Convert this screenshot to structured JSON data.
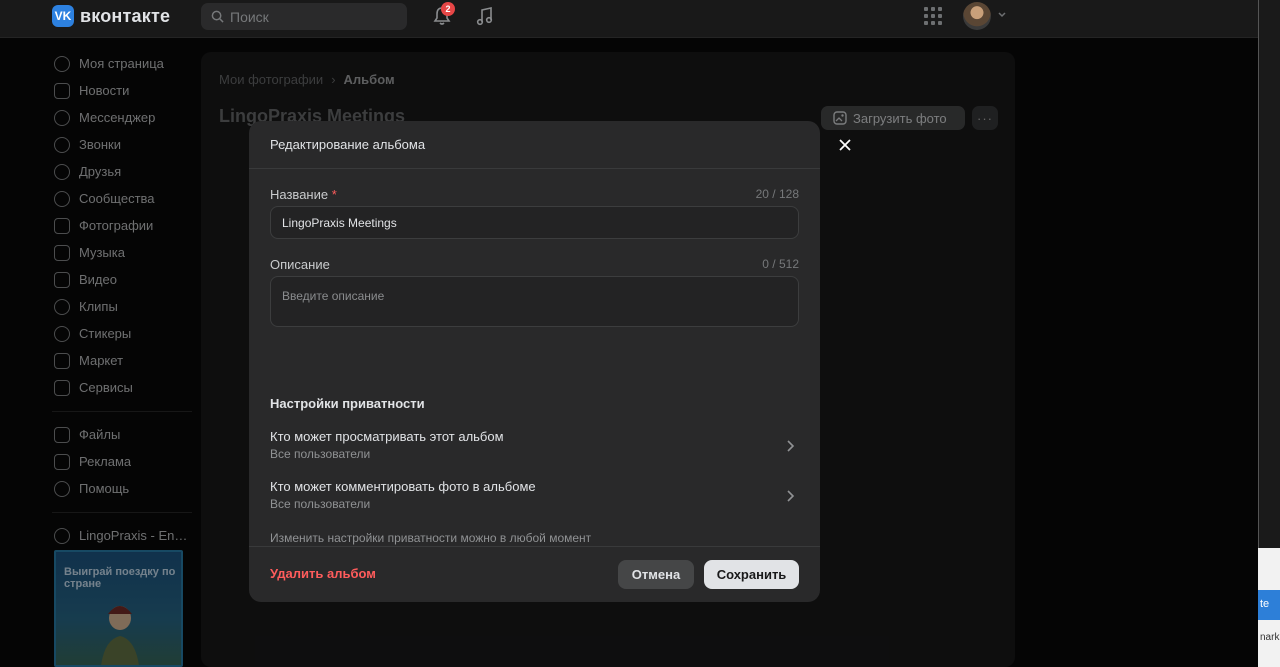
{
  "header": {
    "logo_text": "вконтакте",
    "logo_mark": "VK",
    "search_placeholder": "Поиск",
    "notifications_count": "2"
  },
  "sidebar": {
    "items": [
      {
        "label": "Моя страница",
        "icon": "user-circle-icon"
      },
      {
        "label": "Новости",
        "icon": "news-icon"
      },
      {
        "label": "Мессенджер",
        "icon": "message-icon"
      },
      {
        "label": "Звонки",
        "icon": "phone-icon"
      },
      {
        "label": "Друзья",
        "icon": "friends-icon"
      },
      {
        "label": "Сообщества",
        "icon": "communities-icon"
      },
      {
        "label": "Фотографии",
        "icon": "photo-icon"
      },
      {
        "label": "Музыка",
        "icon": "music-icon"
      },
      {
        "label": "Видео",
        "icon": "video-icon"
      },
      {
        "label": "Клипы",
        "icon": "clips-icon"
      },
      {
        "label": "Стикеры",
        "icon": "sticker-icon"
      },
      {
        "label": "Маркет",
        "icon": "market-icon"
      },
      {
        "label": "Сервисы",
        "icon": "services-icon"
      }
    ],
    "secondary": [
      {
        "label": "Файлы",
        "icon": "file-icon"
      },
      {
        "label": "Реклама",
        "icon": "ads-icon"
      },
      {
        "label": "Помощь",
        "icon": "help-icon"
      }
    ],
    "group": {
      "label": "LingoPraxis - Engl...",
      "icon": "group-icon"
    },
    "promo_text": "Выиграй поездку по стране"
  },
  "page": {
    "breadcrumb_parent": "Мои фотографии",
    "breadcrumb_current": "Альбом",
    "album_title": "LingoPraxis Meetings",
    "upload_label": "Загрузить фото",
    "more_label": "···"
  },
  "modal": {
    "title": "Редактирование альбома",
    "name_label": "Название",
    "name_required": "*",
    "name_counter": "20 / 128",
    "name_value": "LingoPraxis Meetings",
    "desc_label": "Описание",
    "desc_counter": "0 / 512",
    "desc_placeholder": "Введите описание",
    "privacy_title": "Настройки приватности",
    "privacy_view_title": "Кто может просматривать этот альбом",
    "privacy_view_value": "Все пользователи",
    "privacy_comment_title": "Кто может комментировать фото в альбоме",
    "privacy_comment_value": "Все пользователи",
    "privacy_hint": "Изменить настройки приватности можно в любой момент",
    "delete_label": "Удалить альбом",
    "cancel_label": "Отмена",
    "save_label": "Сохранить"
  },
  "edge": {
    "blue_text": "te",
    "bottom_text": "nark"
  },
  "colors": {
    "accent": "#2d81e0",
    "danger": "#ff5c5c",
    "modal_bg": "#29292a",
    "page_bg": "#0a0a0a"
  }
}
